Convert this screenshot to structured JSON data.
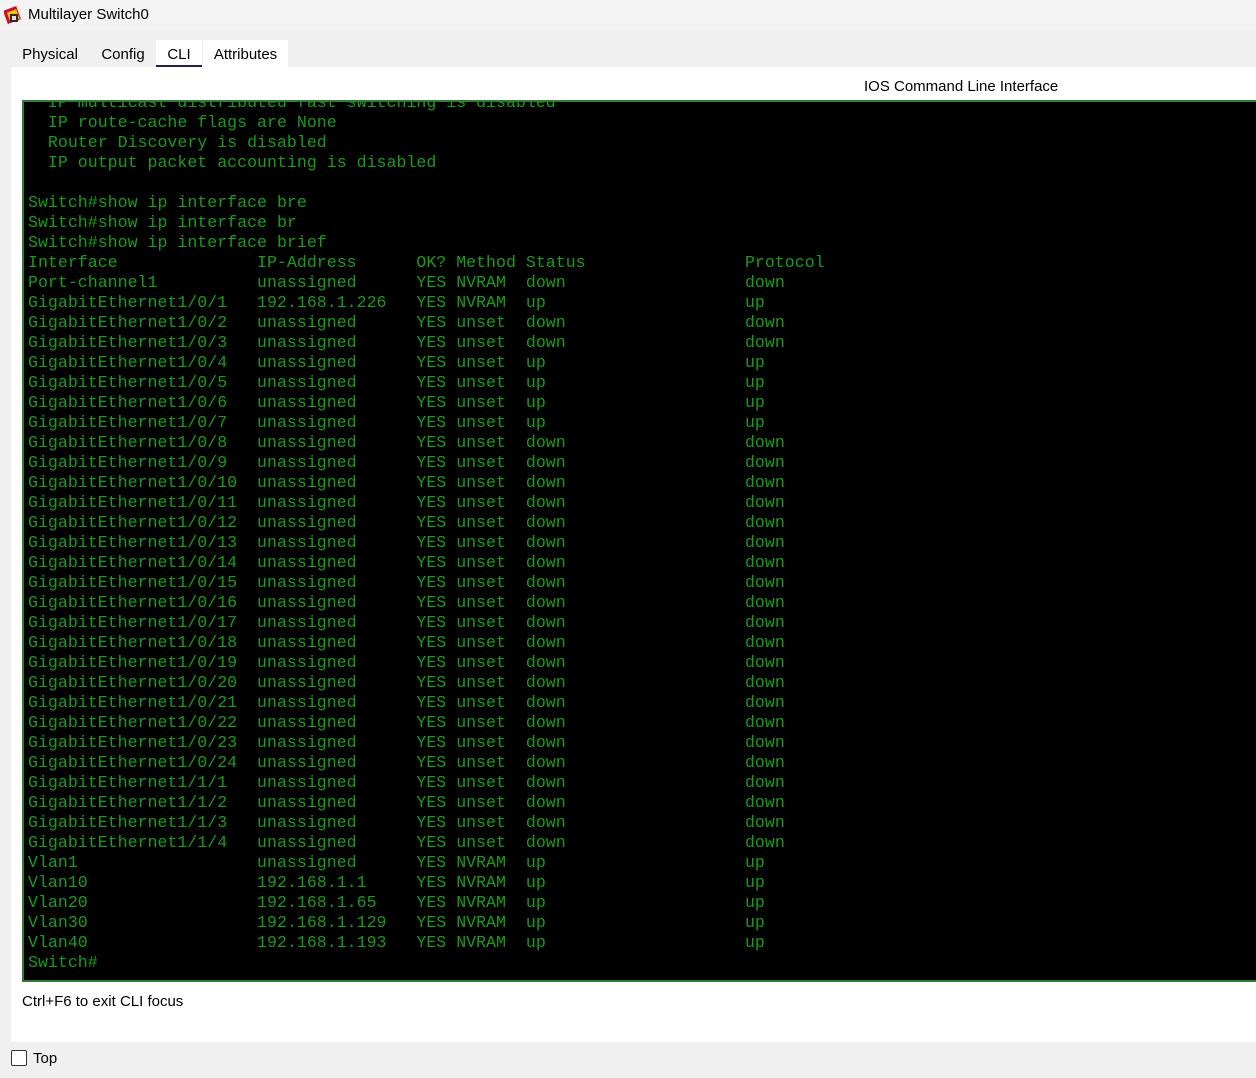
{
  "window": {
    "title": "Multilayer Switch0"
  },
  "tabs": [
    {
      "label": "Physical",
      "active": false
    },
    {
      "label": "Config",
      "active": false
    },
    {
      "label": "CLI",
      "active": true
    },
    {
      "label": "Attributes",
      "active": false
    }
  ],
  "cli": {
    "header": "IOS Command Line Interface",
    "text_color": "#1a9c1a",
    "background_color": "#000000",
    "lines": [
      "  IP multicast distributed fast switching is disabled",
      "  IP route-cache flags are None",
      "  Router Discovery is disabled",
      "  IP output packet accounting is disabled",
      "",
      "Switch#show ip interface bre",
      "Switch#show ip interface br",
      "Switch#show ip interface brief",
      "Interface              IP-Address      OK? Method Status                Protocol",
      "Port-channel1          unassigned      YES NVRAM  down                  down",
      "GigabitEthernet1/0/1   192.168.1.226   YES NVRAM  up                    up",
      "GigabitEthernet1/0/2   unassigned      YES unset  down                  down",
      "GigabitEthernet1/0/3   unassigned      YES unset  down                  down",
      "GigabitEthernet1/0/4   unassigned      YES unset  up                    up",
      "GigabitEthernet1/0/5   unassigned      YES unset  up                    up",
      "GigabitEthernet1/0/6   unassigned      YES unset  up                    up",
      "GigabitEthernet1/0/7   unassigned      YES unset  up                    up",
      "GigabitEthernet1/0/8   unassigned      YES unset  down                  down",
      "GigabitEthernet1/0/9   unassigned      YES unset  down                  down",
      "GigabitEthernet1/0/10  unassigned      YES unset  down                  down",
      "GigabitEthernet1/0/11  unassigned      YES unset  down                  down",
      "GigabitEthernet1/0/12  unassigned      YES unset  down                  down",
      "GigabitEthernet1/0/13  unassigned      YES unset  down                  down",
      "GigabitEthernet1/0/14  unassigned      YES unset  down                  down",
      "GigabitEthernet1/0/15  unassigned      YES unset  down                  down",
      "GigabitEthernet1/0/16  unassigned      YES unset  down                  down",
      "GigabitEthernet1/0/17  unassigned      YES unset  down                  down",
      "GigabitEthernet1/0/18  unassigned      YES unset  down                  down",
      "GigabitEthernet1/0/19  unassigned      YES unset  down                  down",
      "GigabitEthernet1/0/20  unassigned      YES unset  down                  down",
      "GigabitEthernet1/0/21  unassigned      YES unset  down                  down",
      "GigabitEthernet1/0/22  unassigned      YES unset  down                  down",
      "GigabitEthernet1/0/23  unassigned      YES unset  down                  down",
      "GigabitEthernet1/0/24  unassigned      YES unset  down                  down",
      "GigabitEthernet1/1/1   unassigned      YES unset  down                  down",
      "GigabitEthernet1/1/2   unassigned      YES unset  down                  down",
      "GigabitEthernet1/1/3   unassigned      YES unset  down                  down",
      "GigabitEthernet1/1/4   unassigned      YES unset  down                  down",
      "Vlan1                  unassigned      YES NVRAM  up                    up",
      "Vlan10                 192.168.1.1     YES NVRAM  up                    up",
      "Vlan20                 192.168.1.65    YES NVRAM  up                    up",
      "Vlan30                 192.168.1.129   YES NVRAM  up                    up",
      "Vlan40                 192.168.1.193   YES NVRAM  up                    up",
      "Switch#"
    ]
  },
  "footer": {
    "exit_hint": "Ctrl+F6 to exit CLI focus"
  },
  "bottom": {
    "top_label": "Top",
    "top_checked": false
  }
}
